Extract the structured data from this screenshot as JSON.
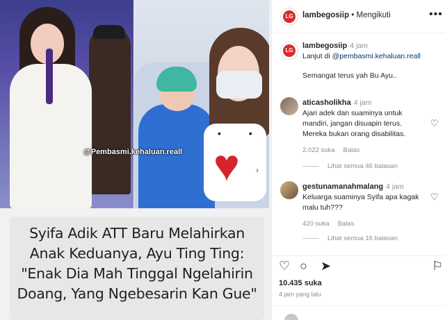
{
  "media": {
    "watermark": "@Pembasmi.kehaluan.reall",
    "headline_lines": [
      "Syifa Adik ATT Baru Melahirkan",
      "Anak Keduanya, Ayu Ting Ting:",
      "\"Enak Dia Mah Tinggal Ngelahirin",
      "Doang, Yang Ngebesarin Kan Gue\""
    ]
  },
  "header": {
    "username": "lambegosiip",
    "separator": " • ",
    "follow_status": "Mengikuti"
  },
  "caption": {
    "username": "lambegosiip",
    "time": "4 jam",
    "line1_prefix": "Lanjut di ",
    "line1_link": "@pembasmi.kehaluan.reall",
    "line2": "Semangat terus yah Bu Ayu.."
  },
  "comments": [
    {
      "username": "aticasholikha",
      "time": "4 jam",
      "text": "Ajari adek dan suaminya untuk mandiri, jangan disuapin terus. Mereka bukan orang disabilitas.",
      "likes": "2.022 suka",
      "reply": "Balas",
      "view_replies": "Lihat semua 46 balasan"
    },
    {
      "username": "gestunamanahmalang",
      "time": "4 jam",
      "text": "Keluarga suaminya Syifa apa kagak malu tuh???",
      "likes": "420 suka",
      "reply": "Balas",
      "view_replies": "Lihat semua 16 balasan"
    }
  ],
  "footer": {
    "likes": "10.435 suka",
    "posted": "4 jam yang lalu"
  }
}
